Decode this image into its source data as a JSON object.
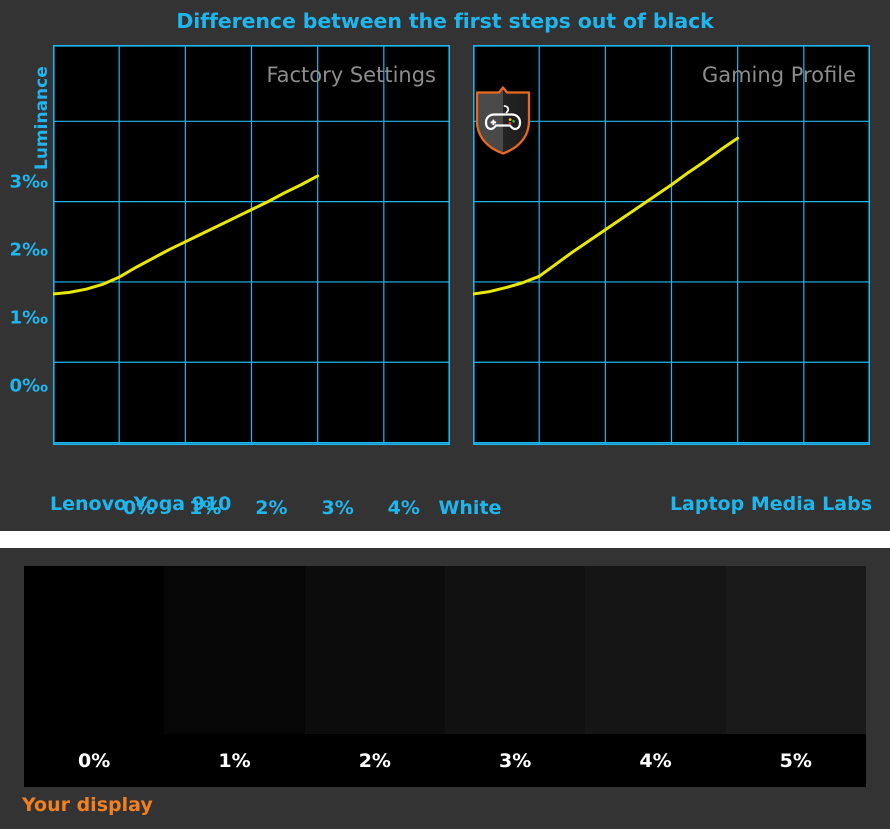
{
  "title": "Difference between the first steps out of black",
  "colors": {
    "panel_bg": "#333333",
    "plot_bg": "#000000",
    "accent_cyan": "#1fb6ee",
    "grid": "#1fb6ee",
    "curve_yellow": "#e8e800",
    "label_gray": "#8c8c8c",
    "orange": "#f08020",
    "shield_border": "#e8691f"
  },
  "y_axis": {
    "label": "Luminance",
    "ticks": [
      "3‰",
      "2‰",
      "1‰",
      "0‰"
    ],
    "tick_values": [
      3,
      2,
      1,
      0
    ]
  },
  "x_axis": {
    "ticks": [
      "0%",
      "1%",
      "2%",
      "3%",
      "4%",
      "White"
    ]
  },
  "charts": [
    {
      "name": "factory-settings",
      "label": "Factory Settings",
      "footer": "Lenovo Yoga 910",
      "footer_align": "left",
      "badge": null
    },
    {
      "name": "gaming-profile",
      "label": "Gaming Profile",
      "footer": "Laptop Media Labs",
      "footer_align": "right",
      "badge": "gamepad-shield-icon"
    }
  ],
  "swatches": {
    "labels": [
      "0%",
      "1%",
      "2%",
      "3%",
      "4%",
      "5%"
    ],
    "fills": [
      "#000000",
      "#060606",
      "#0c0c0c",
      "#111111",
      "#151515",
      "#1a1a1a"
    ],
    "caption": "Your display"
  },
  "chart_data": [
    {
      "type": "line",
      "title": "Difference between the first steps out of black",
      "subtitle": "Factory Settings",
      "xlabel": "",
      "ylabel": "Luminance",
      "xticklabels": [
        "0%",
        "1%",
        "2%",
        "3%",
        "4%",
        "White"
      ],
      "yticklabels": [
        "0‰",
        "1‰",
        "2‰",
        "3‰"
      ],
      "xlim": [
        0,
        6
      ],
      "ylim": [
        -1.03,
        3.95
      ],
      "grid": true,
      "legend": null,
      "series": [
        {
          "name": "Factory Settings",
          "color": "#e8e800",
          "x": [
            0.0,
            0.25,
            0.5,
            0.75,
            1.0,
            1.25,
            1.5,
            1.75,
            2.0,
            2.25,
            2.5,
            2.75,
            3.0,
            3.25,
            3.5,
            3.75,
            4.0
          ],
          "values": [
            0.85,
            0.87,
            0.91,
            0.97,
            1.06,
            1.18,
            1.29,
            1.4,
            1.5,
            1.6,
            1.7,
            1.8,
            1.9,
            2.0,
            2.11,
            2.21,
            2.32
          ]
        }
      ]
    },
    {
      "type": "line",
      "title": "Difference between the first steps out of black",
      "subtitle": "Gaming Profile",
      "xlabel": "",
      "ylabel": "Luminance",
      "xticklabels": [
        "0%",
        "1%",
        "2%",
        "3%",
        "4%",
        "White"
      ],
      "yticklabels": [
        "0‰",
        "1‰",
        "2‰",
        "3‰"
      ],
      "xlim": [
        0,
        6
      ],
      "ylim": [
        -1.03,
        3.95
      ],
      "grid": true,
      "legend": null,
      "series": [
        {
          "name": "Gaming Profile",
          "color": "#e8e800",
          "x": [
            0.0,
            0.25,
            0.5,
            0.75,
            1.0,
            1.25,
            1.5,
            1.75,
            2.0,
            2.25,
            2.5,
            2.75,
            3.0,
            3.25,
            3.5,
            3.75,
            4.0
          ],
          "values": [
            0.85,
            0.88,
            0.93,
            0.99,
            1.07,
            1.22,
            1.37,
            1.51,
            1.65,
            1.79,
            1.93,
            2.07,
            2.21,
            2.36,
            2.5,
            2.65,
            2.79
          ]
        }
      ]
    },
    {
      "type": "heatmap",
      "title": "Your display",
      "categories": [
        "0%",
        "1%",
        "2%",
        "3%",
        "4%",
        "5%"
      ],
      "values": [
        0,
        6,
        12,
        17,
        21,
        26
      ],
      "ylabel": "",
      "xlabel": ""
    }
  ]
}
